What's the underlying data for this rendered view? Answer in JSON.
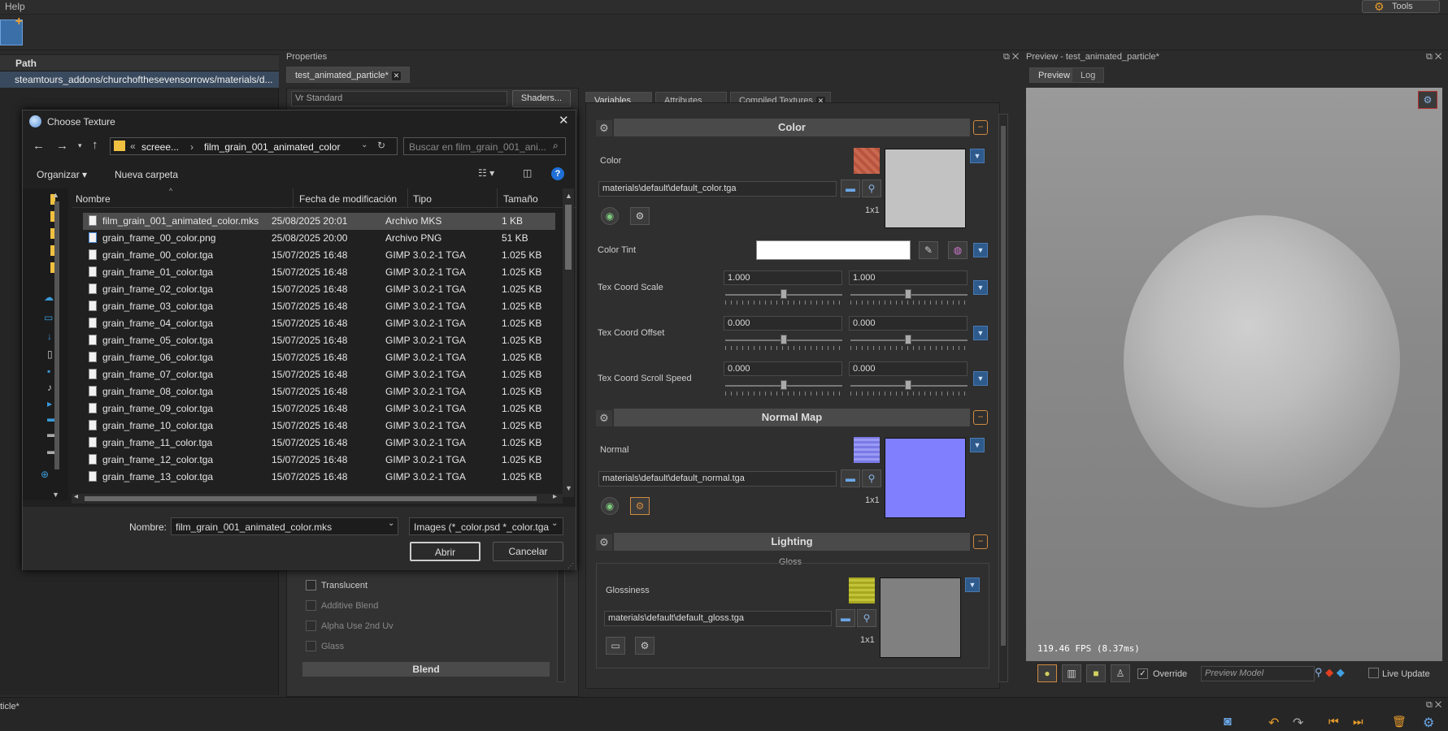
{
  "menubar": {
    "help": "Help",
    "tools": "Tools"
  },
  "left_panel": {
    "column_header": "Path",
    "row_path": "steamtours_addons/churchofthesevensorrows/materials/d..."
  },
  "properties": {
    "title": "Properties",
    "doc_tab": "test_animated_particle*",
    "shader_value": "Vr Standard",
    "shaders_button": "Shaders...",
    "checkboxes": [
      "Translucent",
      "Additive Blend",
      "Alpha Use 2nd Uv",
      "Glass"
    ],
    "blend_header": "Blend"
  },
  "variables": {
    "tabs": [
      "Variables",
      "Attributes",
      "Compiled Textures"
    ],
    "color_section": {
      "title": "Color",
      "label": "Color",
      "path": "materials\\default\\default_color.tga",
      "size": "1x1",
      "tint_label": "Color Tint",
      "scale_label": "Tex Coord Scale",
      "scale_values": [
        "1.000",
        "1.000"
      ],
      "offset_label": "Tex Coord Offset",
      "offset_values": [
        "0.000",
        "0.000"
      ],
      "scroll_label": "Tex Coord Scroll Speed",
      "scroll_values": [
        "0.000",
        "0.000"
      ]
    },
    "normal_section": {
      "title": "Normal Map",
      "label": "Normal",
      "path": "materials\\default\\default_normal.tga",
      "size": "1x1"
    },
    "lighting_section": {
      "title": "Lighting",
      "group": "Gloss",
      "label": "Glossiness",
      "path": "materials\\default\\default_gloss.tga",
      "size": "1x1"
    }
  },
  "preview": {
    "title": "Preview - test_animated_particle*",
    "tabs": [
      "Preview",
      "Log"
    ],
    "fps": "119.46 FPS (8.37ms)",
    "override_label": "Override",
    "model_placeholder": "Preview Model",
    "live_update_label": "Live Update"
  },
  "dialog": {
    "title": "Choose Texture",
    "breadcrumb": [
      "screee...",
      "film_grain_001_animated_color"
    ],
    "search_placeholder": "Buscar en film_grain_001_ani...",
    "organize": "Organizar",
    "new_folder": "Nueva carpeta",
    "columns": [
      "Nombre",
      "Fecha de modificación",
      "Tipo",
      "Tamaño"
    ],
    "files": [
      {
        "name": "film_grain_001_animated_color.mks",
        "date": "25/08/2025 20:01",
        "type": "Archivo MKS",
        "size": "1 KB"
      },
      {
        "name": "grain_frame_00_color.png",
        "date": "25/08/2025 20:00",
        "type": "Archivo PNG",
        "size": "51 KB"
      },
      {
        "name": "grain_frame_00_color.tga",
        "date": "15/07/2025 16:48",
        "type": "GIMP 3.0.2-1 TGA",
        "size": "1.025 KB"
      },
      {
        "name": "grain_frame_01_color.tga",
        "date": "15/07/2025 16:48",
        "type": "GIMP 3.0.2-1 TGA",
        "size": "1.025 KB"
      },
      {
        "name": "grain_frame_02_color.tga",
        "date": "15/07/2025 16:48",
        "type": "GIMP 3.0.2-1 TGA",
        "size": "1.025 KB"
      },
      {
        "name": "grain_frame_03_color.tga",
        "date": "15/07/2025 16:48",
        "type": "GIMP 3.0.2-1 TGA",
        "size": "1.025 KB"
      },
      {
        "name": "grain_frame_04_color.tga",
        "date": "15/07/2025 16:48",
        "type": "GIMP 3.0.2-1 TGA",
        "size": "1.025 KB"
      },
      {
        "name": "grain_frame_05_color.tga",
        "date": "15/07/2025 16:48",
        "type": "GIMP 3.0.2-1 TGA",
        "size": "1.025 KB"
      },
      {
        "name": "grain_frame_06_color.tga",
        "date": "15/07/2025 16:48",
        "type": "GIMP 3.0.2-1 TGA",
        "size": "1.025 KB"
      },
      {
        "name": "grain_frame_07_color.tga",
        "date": "15/07/2025 16:48",
        "type": "GIMP 3.0.2-1 TGA",
        "size": "1.025 KB"
      },
      {
        "name": "grain_frame_08_color.tga",
        "date": "15/07/2025 16:48",
        "type": "GIMP 3.0.2-1 TGA",
        "size": "1.025 KB"
      },
      {
        "name": "grain_frame_09_color.tga",
        "date": "15/07/2025 16:48",
        "type": "GIMP 3.0.2-1 TGA",
        "size": "1.025 KB"
      },
      {
        "name": "grain_frame_10_color.tga",
        "date": "15/07/2025 16:48",
        "type": "GIMP 3.0.2-1 TGA",
        "size": "1.025 KB"
      },
      {
        "name": "grain_frame_11_color.tga",
        "date": "15/07/2025 16:48",
        "type": "GIMP 3.0.2-1 TGA",
        "size": "1.025 KB"
      },
      {
        "name": "grain_frame_12_color.tga",
        "date": "15/07/2025 16:48",
        "type": "GIMP 3.0.2-1 TGA",
        "size": "1.025 KB"
      },
      {
        "name": "grain_frame_13_color.tga",
        "date": "15/07/2025 16:48",
        "type": "GIMP 3.0.2-1 TGA",
        "size": "1.025 KB"
      }
    ],
    "filename_label": "Nombre:",
    "filename_value": "film_grain_001_animated_color.mks",
    "filter_value": "Images (*_color.psd *_color.tga",
    "open_button": "Abrir",
    "cancel_button": "Cancelar"
  },
  "bottom": {
    "tab_label": "ticle*"
  }
}
